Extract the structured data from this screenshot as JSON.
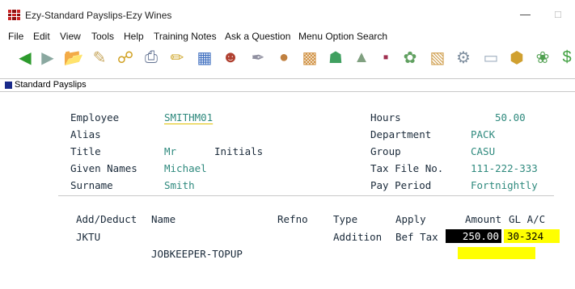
{
  "window": {
    "title": "Ezy-Standard Payslips-Ezy Wines",
    "minimize": "—",
    "restore": "□"
  },
  "menu": [
    "File",
    "Edit",
    "View",
    "Tools",
    "Help",
    "Training Notes",
    "Ask a Question",
    "Menu Option Search"
  ],
  "toolbar": [
    "back-arrow-icon",
    "forward-arrow-icon",
    "open-folder-icon",
    "edit-icon",
    "link-icon",
    "printer-icon",
    "pencil-icon",
    "calendar-icon",
    "users-icon",
    "wrench-icon",
    "barrel-icon",
    "boxes-icon",
    "wine-glass-icon",
    "grape-press-icon",
    "bottle-icon",
    "grapes-icon",
    "cabinet-icon",
    "gear-icon",
    "tile-icon",
    "crate-icon",
    "plant-icon",
    "dollar-icon"
  ],
  "tab": {
    "label": "Standard Payslips"
  },
  "form": {
    "employee_label": "Employee",
    "employee_value": "SMITHM01",
    "alias_label": "Alias",
    "title_label": "Title",
    "title_value": "Mr",
    "initials_label": "Initials",
    "given_label": "Given Names",
    "given_value": "Michael",
    "surname_label": "Surname",
    "surname_value": "Smith",
    "hours_label": "Hours",
    "hours_value": "50.00",
    "dept_label": "Department",
    "dept_value": "PACK",
    "group_label": "Group",
    "group_value": "CASU",
    "tfn_label": "Tax File No.",
    "tfn_value": "111-222-333",
    "period_label": "Pay Period",
    "period_value": "Fortnightly"
  },
  "grid": {
    "headers": {
      "adddeduct": "Add/Deduct",
      "name": "Name",
      "refno": "Refno",
      "type": "Type",
      "apply": "Apply",
      "amount": "Amount",
      "glac": "GL A/C"
    },
    "row": {
      "code": "JKTU",
      "type": "Addition",
      "apply": "Bef Tax",
      "amount": "250.00",
      "glac": "30-324",
      "name": "JOBKEEPER-TOPUP"
    }
  }
}
